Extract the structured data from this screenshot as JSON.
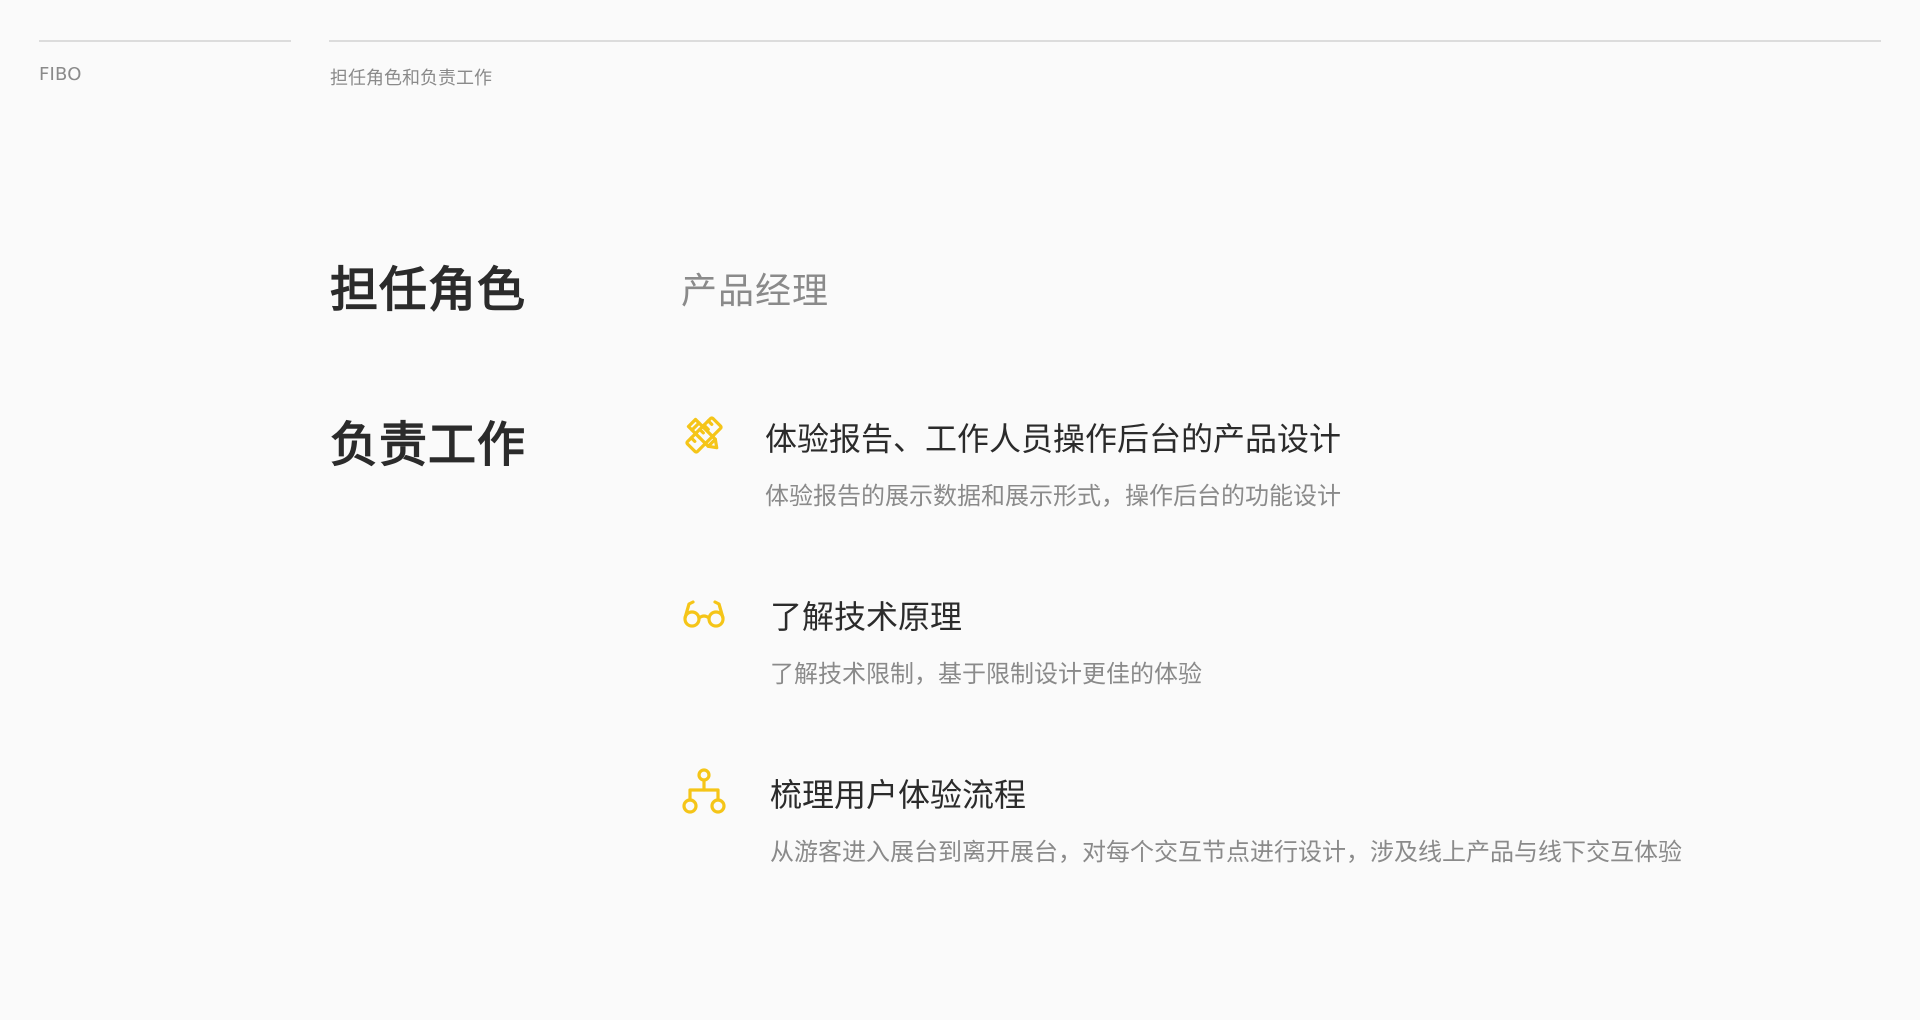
{
  "header": {
    "brand": "FIBO",
    "breadcrumb": "担任角色和负责工作"
  },
  "role": {
    "heading": "担任角色",
    "value": "产品经理"
  },
  "duties": {
    "heading": "负责工作",
    "items": [
      {
        "icon": "pencil-ruler-icon",
        "title": "体验报告、工作人员操作后台的产品设计",
        "description": "体验报告的展示数据和展示形式，操作后台的功能设计"
      },
      {
        "icon": "glasses-icon",
        "title": "了解技术原理",
        "description": "了解技术限制，基于限制设计更佳的体验"
      },
      {
        "icon": "flow-tree-icon",
        "title": "梳理用户体验流程",
        "description": "从游客进入展台到离开展台，对每个交互节点进行设计，涉及线上产品与线下交互体验"
      }
    ]
  },
  "colors": {
    "accent": "#f5c518",
    "text_primary": "#2b2b2b",
    "text_secondary": "#8a8a8a",
    "rule": "#dcdcdc",
    "background": "#fafafa"
  }
}
